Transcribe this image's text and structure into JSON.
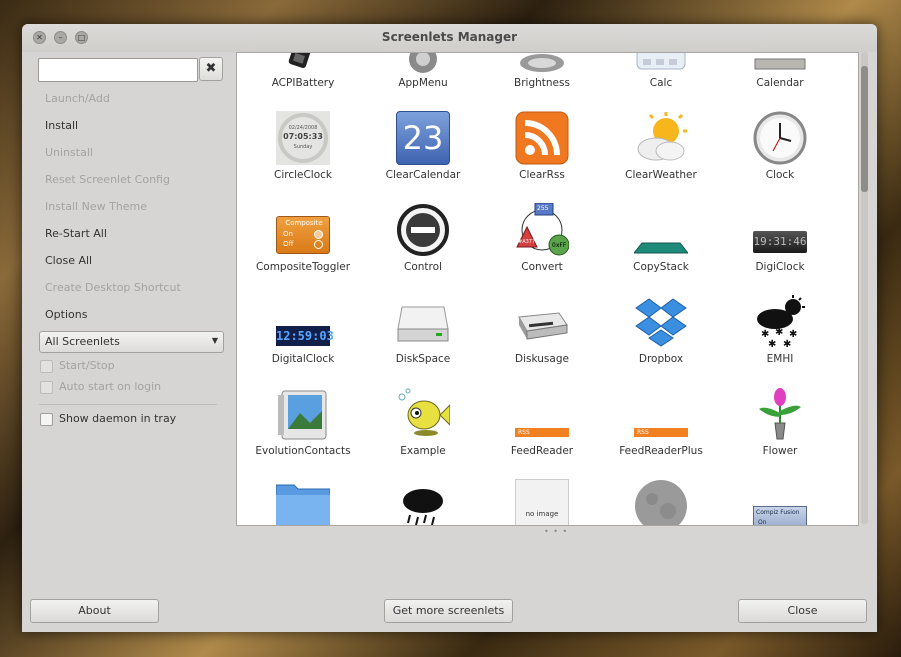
{
  "window": {
    "title": "Screenlets Manager"
  },
  "titlebar": {
    "close_glyph": "✕",
    "min_glyph": "–",
    "max_glyph": "□"
  },
  "search": {
    "value": "",
    "placeholder": ""
  },
  "clear_glyph": "✖",
  "sidebar": {
    "items": [
      {
        "label": "Launch/Add",
        "enabled": false
      },
      {
        "label": "Install",
        "enabled": true
      },
      {
        "label": "Uninstall",
        "enabled": false
      },
      {
        "label": "Reset Screenlet Config",
        "enabled": false
      },
      {
        "label": "Install New Theme",
        "enabled": false
      },
      {
        "label": "Re-Start All",
        "enabled": true
      },
      {
        "label": "Close All",
        "enabled": true
      },
      {
        "label": "Create Desktop Shortcut",
        "enabled": false
      },
      {
        "label": "Options",
        "enabled": true
      }
    ]
  },
  "filter": {
    "selected": "All Screenlets",
    "arrow": "▼"
  },
  "options": {
    "start_stop": {
      "label": "Start/Stop",
      "checked": false,
      "enabled": false
    },
    "autostart": {
      "label": "Auto start on login",
      "checked": false,
      "enabled": false
    },
    "daemon": {
      "label": "Show daemon in tray",
      "checked": false,
      "enabled": true
    }
  },
  "icons": {
    "calendar_day": "23",
    "circleclock": {
      "date": "02/24/2008",
      "time": "07:05:33",
      "day": "Sunday"
    },
    "composite": {
      "title": "Composite",
      "on": "On",
      "off": "Off"
    },
    "convert": {
      "top": "255",
      "left": "#A377",
      "right": "0xFF"
    },
    "digiclock": "19:31:46",
    "digitalclock": "12:59:03",
    "feed_badge": "RSS",
    "noimage": "no image",
    "compiz": {
      "title": "Compiz Fusion",
      "state": "On"
    }
  },
  "screenlets": [
    {
      "name": "ACPIBattery",
      "icon": "battery-icon"
    },
    {
      "name": "AppMenu",
      "icon": "gear-icon"
    },
    {
      "name": "Brightness",
      "icon": "brightness-icon"
    },
    {
      "name": "Calc",
      "icon": "calculator-icon"
    },
    {
      "name": "Calendar",
      "icon": "calendar-icon"
    },
    {
      "name": "CircleClock",
      "icon": "circle-clock-icon"
    },
    {
      "name": "ClearCalendar",
      "icon": "clear-calendar-icon"
    },
    {
      "name": "ClearRss",
      "icon": "rss-icon"
    },
    {
      "name": "ClearWeather",
      "icon": "weather-sun-cloud-icon"
    },
    {
      "name": "Clock",
      "icon": "analog-clock-icon"
    },
    {
      "name": "CompositeToggler",
      "icon": "composite-toggler-icon"
    },
    {
      "name": "Control",
      "icon": "control-icon"
    },
    {
      "name": "Convert",
      "icon": "convert-icon"
    },
    {
      "name": "CopyStack",
      "icon": "copystack-icon"
    },
    {
      "name": "DigiClock",
      "icon": "digiclock-icon"
    },
    {
      "name": "DigitalClock",
      "icon": "digital-clock-icon"
    },
    {
      "name": "DiskSpace",
      "icon": "disk-icon"
    },
    {
      "name": "Diskusage",
      "icon": "drive-icon"
    },
    {
      "name": "Dropbox",
      "icon": "dropbox-icon"
    },
    {
      "name": "EMHI",
      "icon": "snow-weather-icon"
    },
    {
      "name": "EvolutionContacts",
      "icon": "contacts-icon"
    },
    {
      "name": "Example",
      "icon": "fish-icon"
    },
    {
      "name": "FeedReader",
      "icon": "feed-reader-icon"
    },
    {
      "name": "FeedReaderPlus",
      "icon": "feed-reader-icon"
    },
    {
      "name": "Flower",
      "icon": "flower-icon"
    },
    {
      "name": "",
      "icon": "folder-icon"
    },
    {
      "name": "",
      "icon": "rain-cloud-icon"
    },
    {
      "name": "",
      "icon": "no-image-icon"
    },
    {
      "name": "",
      "icon": "moon-icon"
    },
    {
      "name": "",
      "icon": "compiz-icon"
    }
  ],
  "buttons": {
    "about": "About",
    "more": "Get more screenlets",
    "close": "Close"
  },
  "colors": {
    "window_bg": "#d6d5d3",
    "accent_rss": "#f07820",
    "dropbox_blue": "#3a8fe0"
  }
}
